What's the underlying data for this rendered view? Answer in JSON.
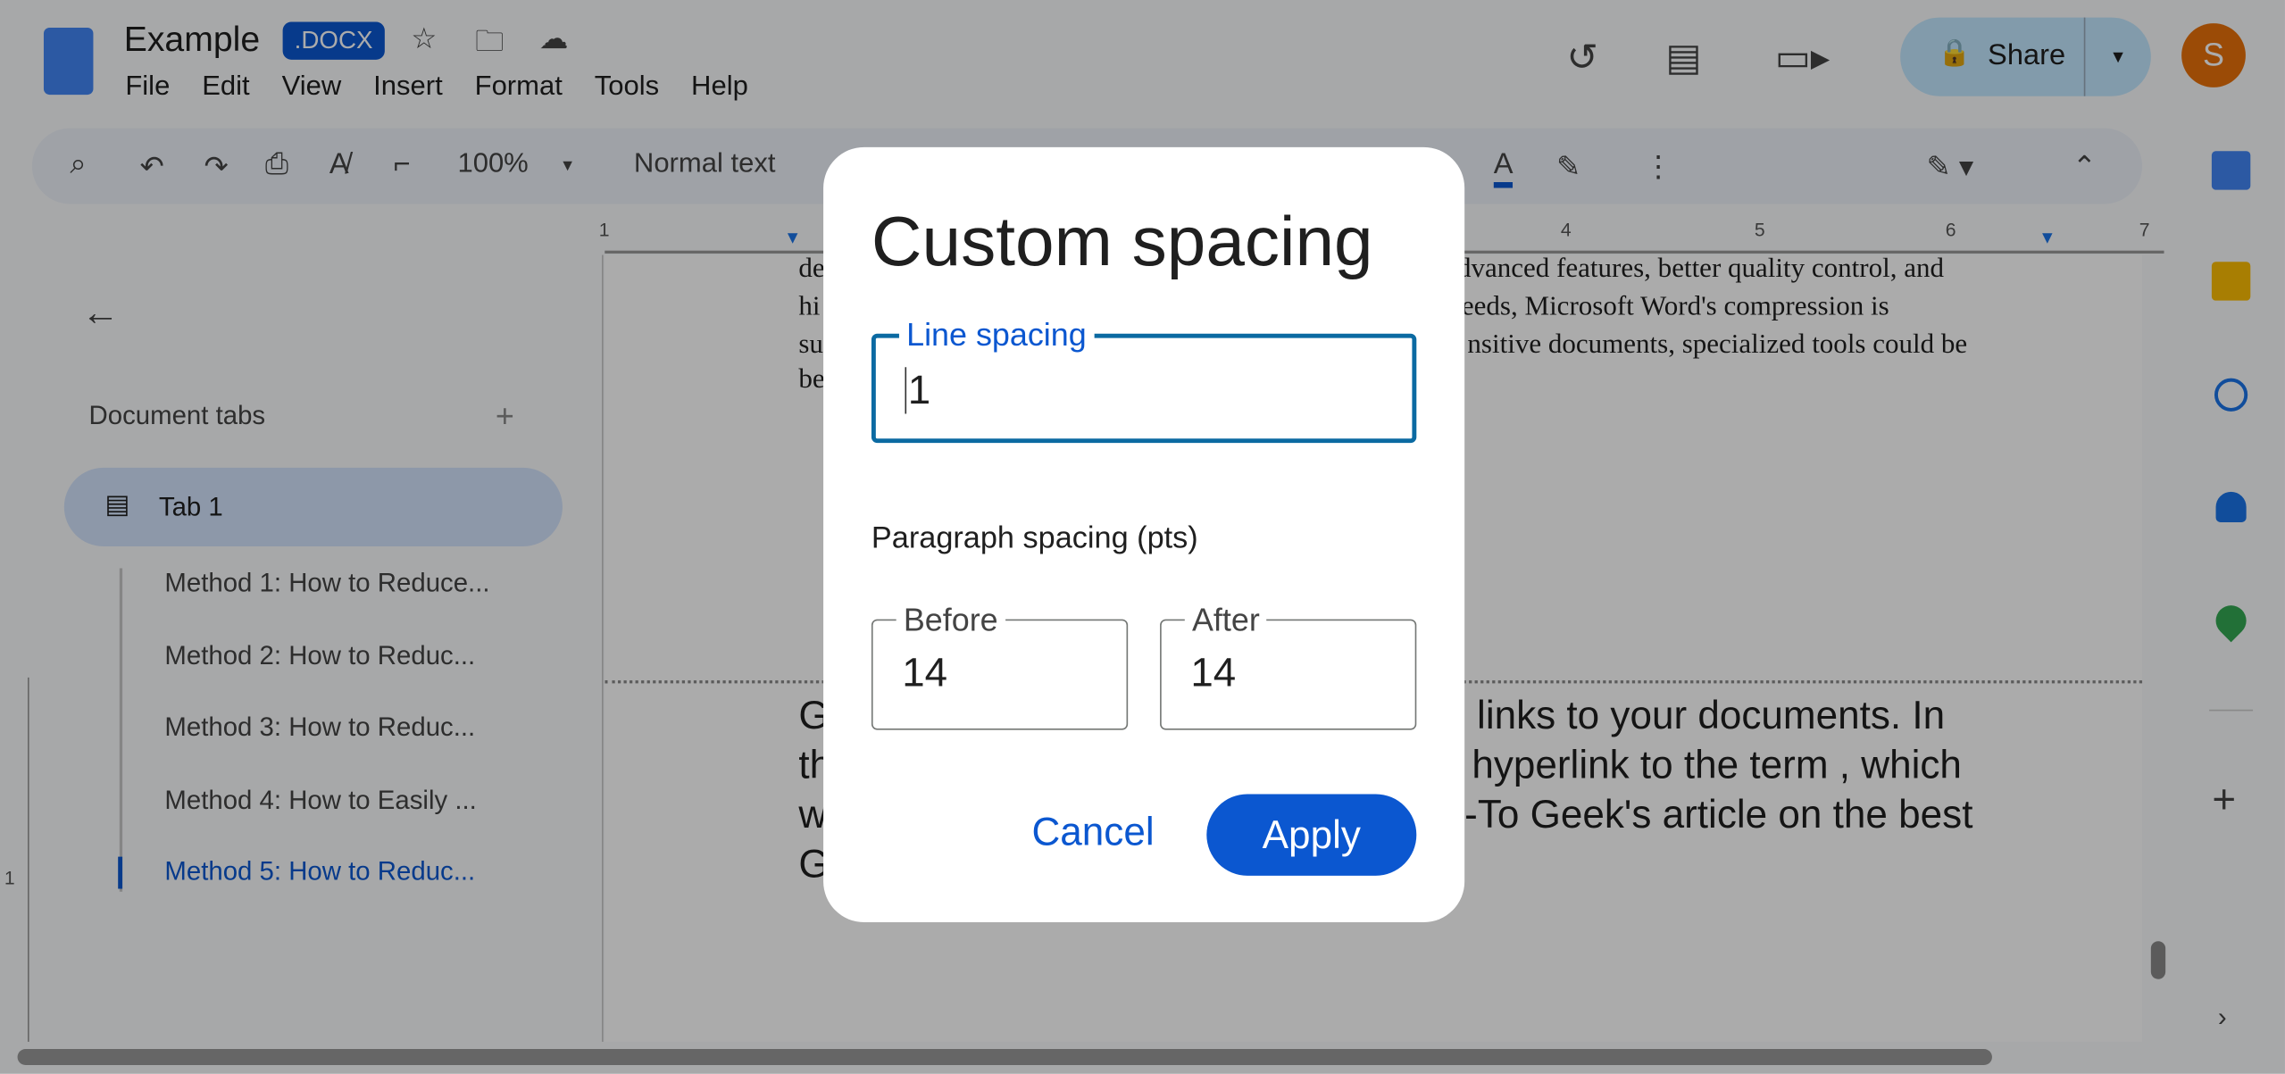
{
  "app": {
    "doc_title": "Example",
    "badge": ".DOCX",
    "menu": [
      "File",
      "Edit",
      "View",
      "Insert",
      "Format",
      "Tools",
      "Help"
    ],
    "share_label": "Share",
    "avatar_letter": "S",
    "accent": "#0b57d0"
  },
  "toolbar": {
    "zoom": "100%",
    "style": "Normal text"
  },
  "ruler": [
    "1",
    "4",
    "5",
    "6",
    "7"
  ],
  "sidebar": {
    "title": "Document tabs",
    "tab": "Tab 1",
    "headings": [
      "Method 1: How to Reduce...",
      "Method 2: How to Reduc...",
      "Method 3: How to Reduc...",
      "Method 4: How to Easily ...",
      "Method 5: How to Reduc..."
    ],
    "active_index": 4
  },
  "doc": {
    "serif_lines": [
      "de",
      "hi",
      "su",
      "be"
    ],
    "serif_right": [
      "dvanced features, better quality control, and",
      "eeds, Microsoft Word's compression is",
      "nsitive documents, specialized tools could be"
    ],
    "sans_left": [
      "G",
      "th",
      "w",
      "G"
    ],
    "sans_right": [
      "l links to your documents. In",
      "hyperlink to the term , which",
      "-To Geek's article on the best"
    ],
    "vruler": "1"
  },
  "dialog": {
    "title": "Custom spacing",
    "line_label": "Line spacing",
    "line_value": "1",
    "para_label": "Paragraph spacing (pts)",
    "before_label": "Before",
    "before_value": "14",
    "after_label": "After",
    "after_value": "14",
    "cancel": "Cancel",
    "apply": "Apply"
  }
}
